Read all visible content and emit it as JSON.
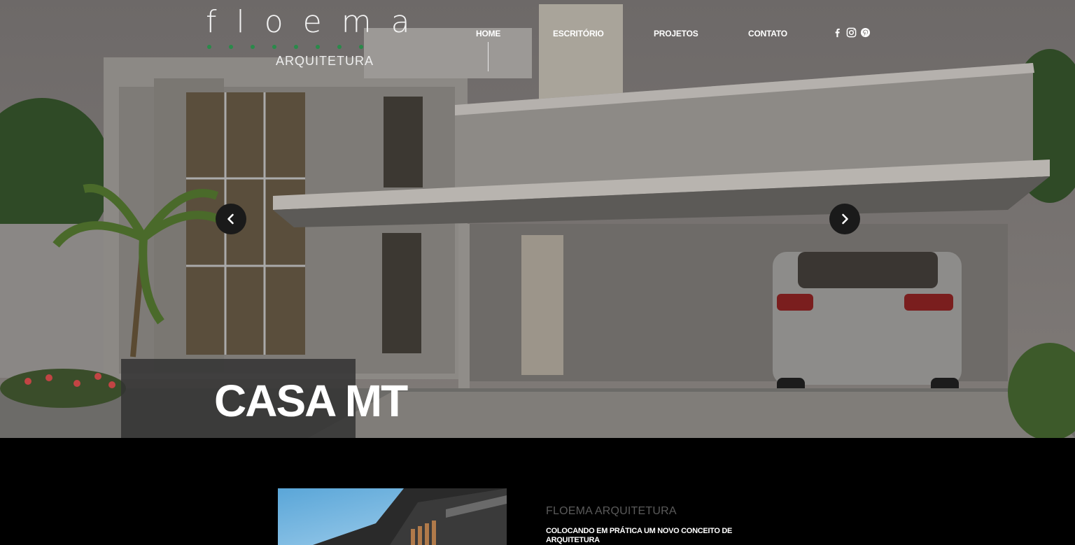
{
  "brand": {
    "logo_word": "floema",
    "logo_sub": "ARQUITETURA",
    "dot_color": "#2a8a4a"
  },
  "nav": {
    "items": [
      {
        "label": "HOME",
        "active": true
      },
      {
        "label": "ESCRITÓRIO",
        "active": false
      },
      {
        "label": "PROJETOS",
        "active": false
      },
      {
        "label": "CONTATO",
        "active": false
      }
    ]
  },
  "social": {
    "icons": [
      "facebook-icon",
      "instagram-icon",
      "pinterest-icon"
    ]
  },
  "hero": {
    "caption": "CASA MT",
    "prev_icon": "chevron-left-icon",
    "next_icon": "chevron-right-icon"
  },
  "about": {
    "kicker": "FLOEMA ARQUITETURA",
    "headline": "COLOCANDO EM PRÁTICA UM NOVO CONCEITO DE ARQUITETURA"
  }
}
